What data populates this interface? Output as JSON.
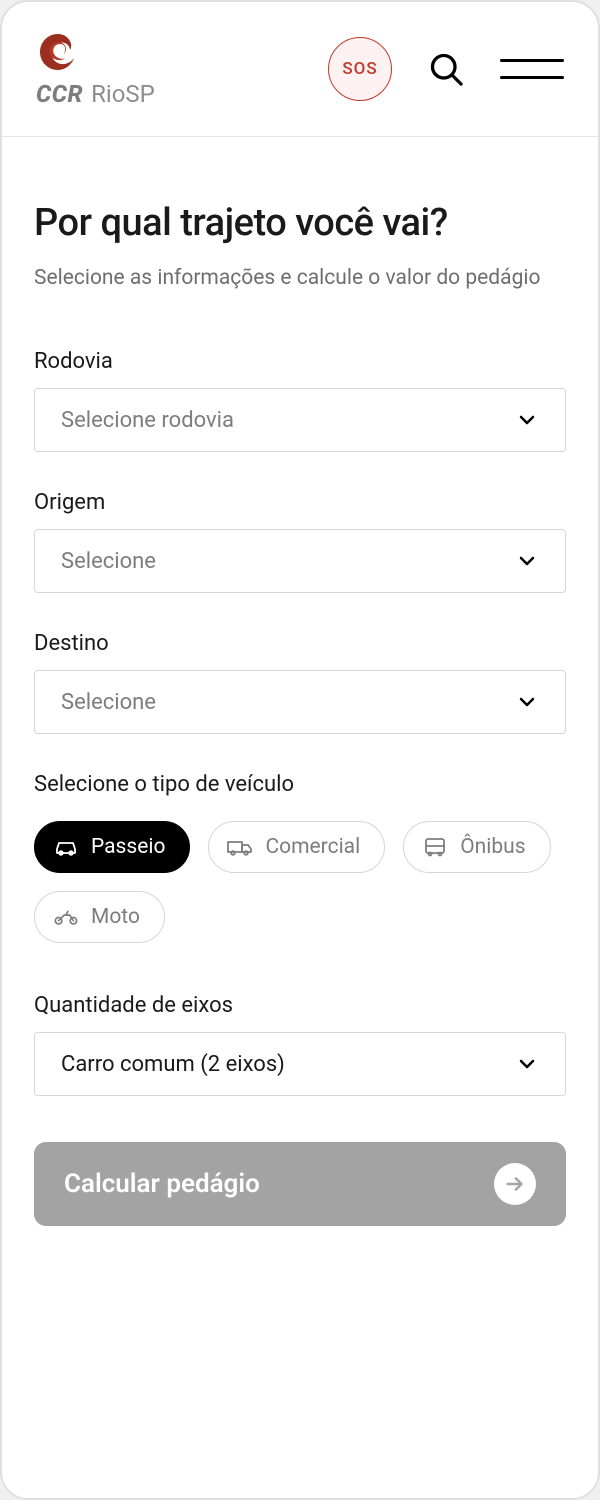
{
  "header": {
    "brand_bold": "CCR",
    "brand_thin": "RioSP",
    "sos_label": "SOS"
  },
  "main": {
    "title": "Por qual trajeto você vai?",
    "subtitle": "Selecione as informações e calcule o valor do pedágio",
    "rodovia_label": "Rodovia",
    "rodovia_placeholder": "Selecione rodovia",
    "origem_label": "Origem",
    "origem_placeholder": "Selecione",
    "destino_label": "Destino",
    "destino_placeholder": "Selecione",
    "veiculo_label": "Selecione o tipo de veículo",
    "veiculos": {
      "passeio": "Passeio",
      "comercial": "Comercial",
      "onibus": "Ônibus",
      "moto": "Moto"
    },
    "eixos_label": "Quantidade de eixos",
    "eixos_value": "Carro comum (2 eixos)",
    "cta_label": "Calcular pedágio"
  }
}
